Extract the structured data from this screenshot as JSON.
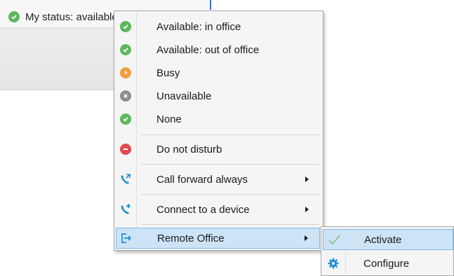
{
  "status_bar": {
    "text": "My status: available in off",
    "icon": "check-circle-icon",
    "color": "#5cb85c"
  },
  "menu": {
    "items": [
      {
        "label": "Available: in office",
        "icon": "check-circle-icon"
      },
      {
        "label": "Available: out of office",
        "icon": "check-circle-icon"
      },
      {
        "label": "Busy",
        "icon": "clock-circle-icon"
      },
      {
        "label": "Unavailable",
        "icon": "x-circle-icon"
      },
      {
        "label": "None",
        "icon": "check-circle-icon"
      },
      {
        "label": "Do not disturb",
        "icon": "minus-circle-icon"
      },
      {
        "label": "Call forward always",
        "icon": "phone-forward-icon",
        "submenu": true
      },
      {
        "label": "Connect to a device",
        "icon": "phone-plus-icon",
        "submenu": true
      },
      {
        "label": "Remote Office",
        "icon": "exit-arrow-icon",
        "submenu": true,
        "highlighted": true
      }
    ]
  },
  "submenu": {
    "items": [
      {
        "label": "Activate",
        "icon": "checkmark-icon",
        "highlighted": true
      },
      {
        "label": "Configure",
        "icon": "gear-icon"
      }
    ]
  },
  "colors": {
    "available": "#5cb85c",
    "busy": "#f0a044",
    "unavailable": "#8c8c8c",
    "dnd": "#e24b4b",
    "accent": "#1e8fd6",
    "highlight_bg": "#cde4f7",
    "highlight_border": "#7fb5e4"
  }
}
